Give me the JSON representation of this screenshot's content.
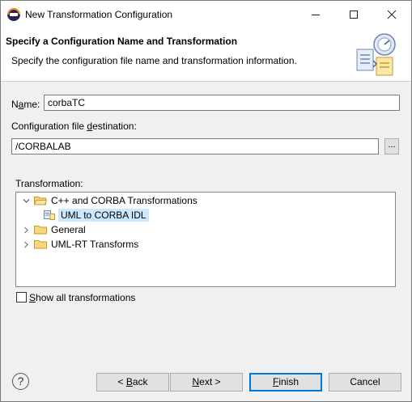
{
  "window": {
    "title": "New Transformation Configuration"
  },
  "banner": {
    "title": "Specify a Configuration Name and Transformation",
    "description": "Specify the configuration file name and transformation information."
  },
  "form": {
    "name_label_pre": "N",
    "name_label_ul": "a",
    "name_label_post": "me:",
    "name_value": "corbaTC",
    "dest_label_pre": "Configuration file ",
    "dest_label_ul": "d",
    "dest_label_post": "estination:",
    "dest_value": "/CORBALAB",
    "browse_label": "...",
    "transformation_label": "Transformation:",
    "show_all_pre": "",
    "show_all_ul": "S",
    "show_all_post": "how all transformations",
    "show_all_checked": false
  },
  "tree": {
    "items": [
      {
        "label": "C++ and CORBA Transformations",
        "expanded": true,
        "icon": "folder-open-icon"
      },
      {
        "label": "UML to CORBA IDL",
        "selected": true,
        "icon": "transform-icon"
      },
      {
        "label": "General",
        "expanded": false,
        "icon": "folder-icon"
      },
      {
        "label": "UML-RT Transforms",
        "expanded": false,
        "icon": "folder-icon"
      }
    ]
  },
  "buttons": {
    "help": "?",
    "back_pre": "< ",
    "back_ul": "B",
    "back_post": "ack",
    "next_ul": "N",
    "next_post": "ext >",
    "finish_ul": "F",
    "finish_post": "inish",
    "cancel": "Cancel"
  },
  "colors": {
    "selection": "#cce8ff",
    "default_button_border": "#0078d7",
    "folder": "#e8b84a"
  }
}
